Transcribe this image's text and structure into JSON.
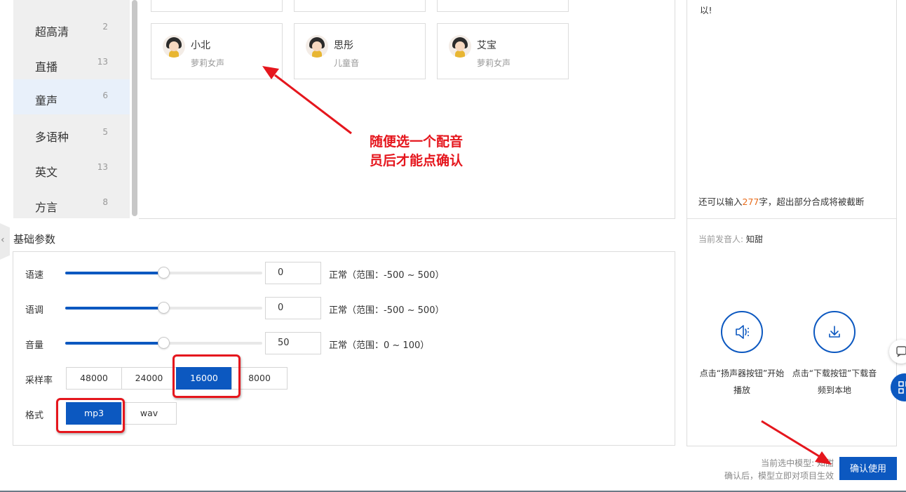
{
  "sidebar": {
    "items": [
      {
        "label": "超高清",
        "count": "2",
        "active": false
      },
      {
        "label": "直播",
        "count": "13",
        "active": false
      },
      {
        "label": "童声",
        "count": "6",
        "active": true
      },
      {
        "label": "多语种",
        "count": "5",
        "active": false
      },
      {
        "label": "英文",
        "count": "13",
        "active": false
      },
      {
        "label": "方言",
        "count": "8",
        "active": false
      }
    ]
  },
  "voices": [
    {
      "name": "小北",
      "type": "萝莉女声"
    },
    {
      "name": "思彤",
      "type": "儿童音"
    },
    {
      "name": "艾宝",
      "type": "萝莉女声"
    }
  ],
  "params": {
    "title": "基础参数",
    "speed": {
      "label": "语速",
      "value": "0",
      "note": "正常（范围：-500 ~ 500）",
      "level_percent": 50
    },
    "pitch": {
      "label": "语调",
      "value": "0",
      "note": "正常（范围：-500 ~ 500）",
      "level_percent": 50
    },
    "volume": {
      "label": "音量",
      "value": "50",
      "note": "正常（范围：0 ~ 100）",
      "level_percent": 50
    },
    "sample_rate": {
      "label": "采样率",
      "options": [
        "48000",
        "24000",
        "16000",
        "8000"
      ],
      "selected": "16000"
    },
    "format": {
      "label": "格式",
      "options": [
        "mp3",
        "wav"
      ],
      "selected": "mp3"
    }
  },
  "right_panel": {
    "text_tail": "以!",
    "char_hint_prefix": "还可以输入",
    "char_hint_count": "277",
    "char_hint_suffix": "字，超出部分合成将被截断",
    "speaker_label": "当前发音人:",
    "speaker_name": "知甜",
    "play_caption": "点击“扬声器按钮”开始播放",
    "download_caption": "点击“下载按钮”下载音频到本地"
  },
  "footer": {
    "model_label": "当前选中模型:",
    "model_name": "知甜",
    "confirm_note": "确认后，模型立即对项目生效",
    "confirm_button": "确认使用"
  },
  "annotation": {
    "line1": "随便选一个配音",
    "line2": "员后才能点确认"
  },
  "colors": {
    "accent": "#0c58c0",
    "annotation_red": "#e5161d",
    "count_orange": "#e86b1a"
  },
  "icons": [
    "speaker-icon",
    "download-icon",
    "chevron-left-icon",
    "feedback-icon",
    "apps-icon"
  ]
}
